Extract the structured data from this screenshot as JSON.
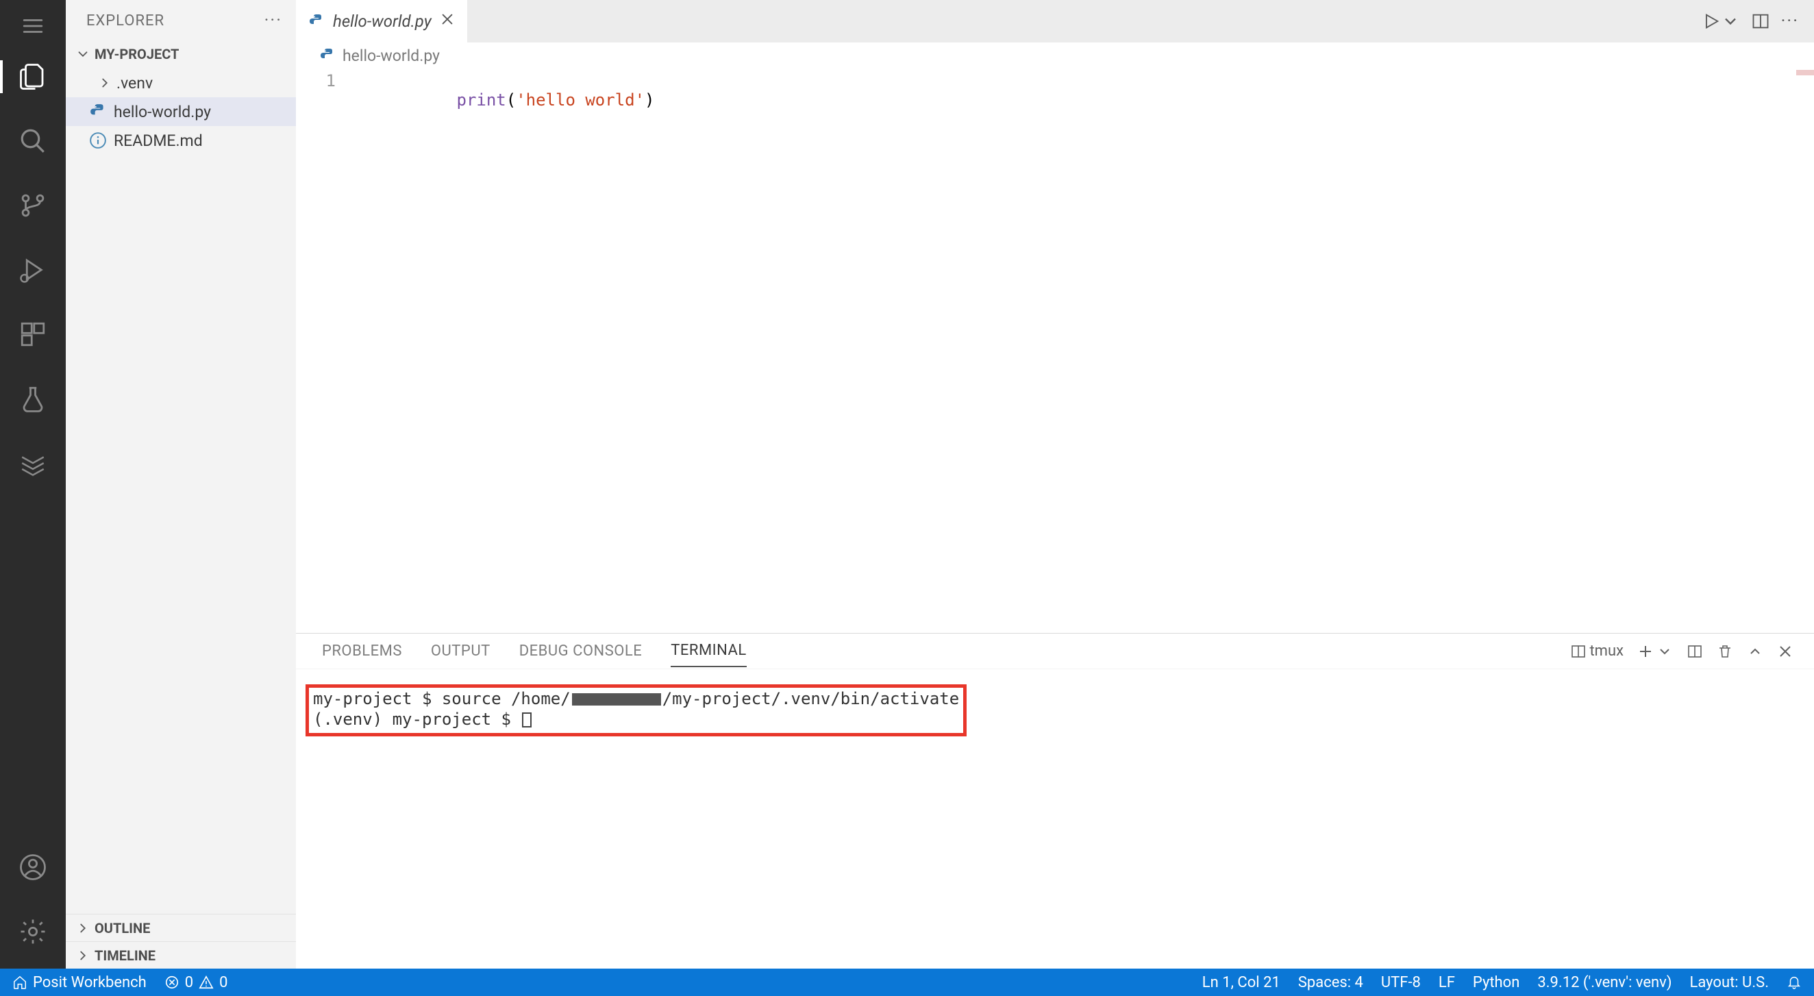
{
  "sidebar": {
    "header": "EXPLORER",
    "folder": "MY-PROJECT",
    "outline": "OUTLINE",
    "timeline": "TIMELINE",
    "items": [
      {
        "type": "folder",
        "name": ".venv"
      },
      {
        "type": "file",
        "name": "hello-world.py",
        "icon": "python",
        "selected": true
      },
      {
        "type": "file",
        "name": "README.md",
        "icon": "info"
      }
    ]
  },
  "tabs": {
    "active": {
      "name": "hello-world.py",
      "icon": "python"
    }
  },
  "breadcrumb": {
    "file": "hello-world.py"
  },
  "editor": {
    "line_number": "1",
    "tokens": {
      "fn": "print",
      "open": "(",
      "str": "'hello world'",
      "close": ")"
    }
  },
  "panel": {
    "tabs": {
      "problems": "PROBLEMS",
      "output": "OUTPUT",
      "debug_console": "DEBUG CONSOLE",
      "terminal": "TERMINAL"
    },
    "terminal": {
      "shell_label": "tmux",
      "line1_a": "my-project $ source /home/",
      "line1_b": "/my-project/.venv/bin/activate",
      "line2": "(.venv) my-project $ "
    }
  },
  "status": {
    "workbench": "Posit Workbench",
    "errors": "0",
    "warnings": "0",
    "cursor": "Ln 1, Col 21",
    "spaces": "Spaces: 4",
    "encoding": "UTF-8",
    "eol": "LF",
    "lang": "Python",
    "interp": "3.9.12 ('.venv': venv)",
    "layout": "Layout: U.S."
  }
}
